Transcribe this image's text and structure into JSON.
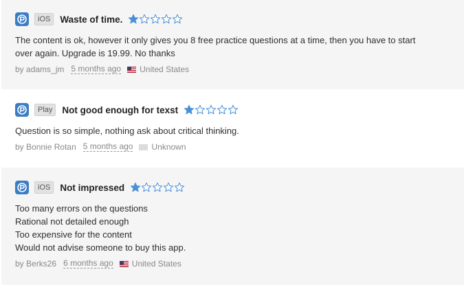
{
  "reviews": [
    {
      "platform": "iOS",
      "title": "Waste of time.",
      "rating": 1,
      "max_rating": 5,
      "body_lines": [
        "The content is ok, however it only gives you 8 free practice questions at a time, then you have to start",
        "over again. Upgrade is 19.99. No thanks"
      ],
      "author_prefix": "by",
      "author": "adams_jm",
      "time_ago": "5 months ago",
      "country": "United States",
      "flag": "us-flag-icon"
    },
    {
      "platform": "Play",
      "title": "Not good enough for texst",
      "rating": 1,
      "max_rating": 5,
      "body_lines": [
        "Question is so simple, nothing ask about critical thinking."
      ],
      "author_prefix": "by",
      "author": "Bonnie Rotan",
      "time_ago": "5 months ago",
      "country": "Unknown",
      "flag": "unknown-flag-icon"
    },
    {
      "platform": "iOS",
      "title": "Not impressed",
      "rating": 1,
      "max_rating": 5,
      "body_lines": [
        "Too many errors on the questions",
        "Rational not detailed enough",
        "Too expensive for the content",
        "Would not advise someone to buy this app."
      ],
      "author_prefix": "by",
      "author": "Berks26",
      "time_ago": "6 months ago",
      "country": "United States",
      "flag": "us-flag-icon"
    }
  ],
  "colors": {
    "app_icon": "#3a7dc4",
    "star_filled": "#4a90d9",
    "star_empty_stroke": "#4a90d9",
    "shaded_row": "#f5f5f5"
  }
}
